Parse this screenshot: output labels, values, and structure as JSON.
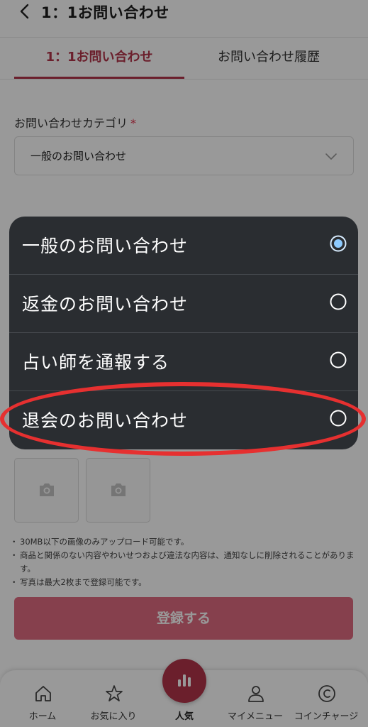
{
  "header": {
    "title": "1：1お問い合わせ"
  },
  "tabs": [
    {
      "label": "1：1お問い合わせ",
      "active": true
    },
    {
      "label": "お問い合わせ履歴",
      "active": false
    }
  ],
  "category": {
    "label": "お問い合わせカテゴリ",
    "required_mark": "*",
    "selected": "一般のお問い合わせ"
  },
  "notes": [
    "30MB以下の画像のみアップロード可能です。",
    "商品と関係のない内容やわいせつおよび違法な内容は、通知なしに削除されることがあります。",
    "写真は最大2枚まで登録可能です。"
  ],
  "submit_label": "登録する",
  "bottom_nav": [
    {
      "label": "ホーム",
      "icon": "home-icon"
    },
    {
      "label": "お気に入り",
      "icon": "star-icon"
    },
    {
      "label": "人気",
      "icon": "bar-chart-icon"
    },
    {
      "label": "マイメニュー",
      "icon": "person-icon"
    },
    {
      "label": "コインチャージ",
      "icon": "coin-icon"
    }
  ],
  "popup": {
    "options": [
      {
        "label": "一般のお問い合わせ",
        "selected": true
      },
      {
        "label": "返金のお問い合わせ",
        "selected": false
      },
      {
        "label": "占い師を通報する",
        "selected": false
      },
      {
        "label": "退会のお問い合わせ",
        "selected": false
      }
    ]
  },
  "colors": {
    "accent": "#b3354a",
    "submit": "#e06c81",
    "popup_bg": "#2a2d31",
    "radio_selected": "#8ecbff",
    "highlight": "#e63030"
  }
}
